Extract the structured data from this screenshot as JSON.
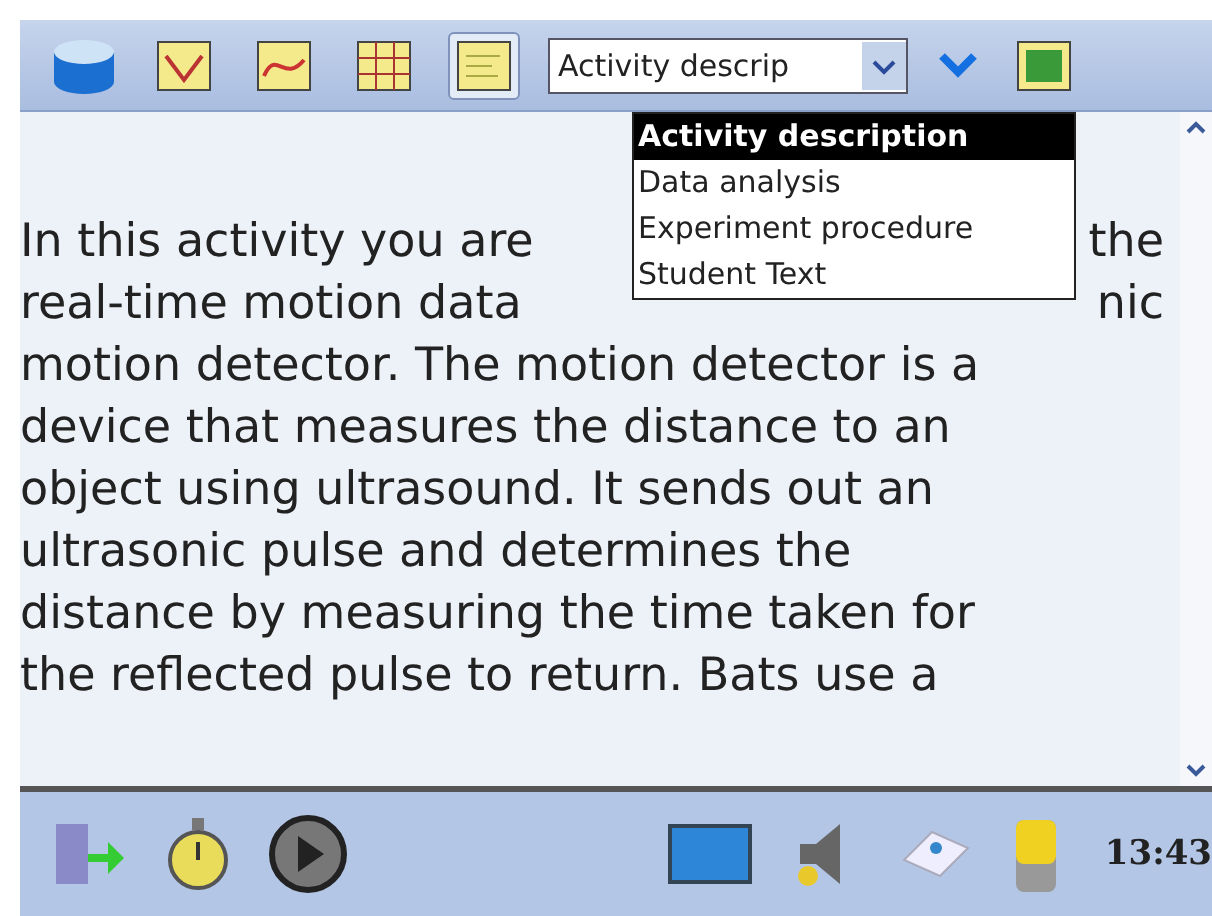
{
  "toolbar": {
    "tabs": [
      {
        "kind": "database",
        "selected": false
      },
      {
        "kind": "meter",
        "selected": false
      },
      {
        "kind": "graph",
        "selected": false
      },
      {
        "kind": "table",
        "selected": false
      },
      {
        "kind": "notes",
        "selected": true
      },
      {
        "kind": "picture",
        "selected": false
      }
    ],
    "select": {
      "value": "Activity descrip"
    }
  },
  "dropdown": {
    "options": [
      {
        "label": "Activity description",
        "selected": true
      },
      {
        "label": "Data analysis",
        "selected": false
      },
      {
        "label": "Experiment procedure",
        "selected": false
      },
      {
        "label": "Student Text",
        "selected": false
      }
    ]
  },
  "content": {
    "lines": [
      [
        "In this activity you are",
        "the"
      ],
      [
        "real-time motion data",
        "nic"
      ],
      [
        "motion detector. The motion detector is a"
      ],
      [
        "device that measures the distance to an"
      ],
      [
        "object using ultrasound. It sends out an"
      ],
      [
        "ultrasonic pulse and determines the"
      ],
      [
        "distance by measuring the time taken for"
      ],
      [
        "the reflected pulse to return. Bats use a"
      ]
    ]
  },
  "taskbar": {
    "clock": "13:43"
  }
}
